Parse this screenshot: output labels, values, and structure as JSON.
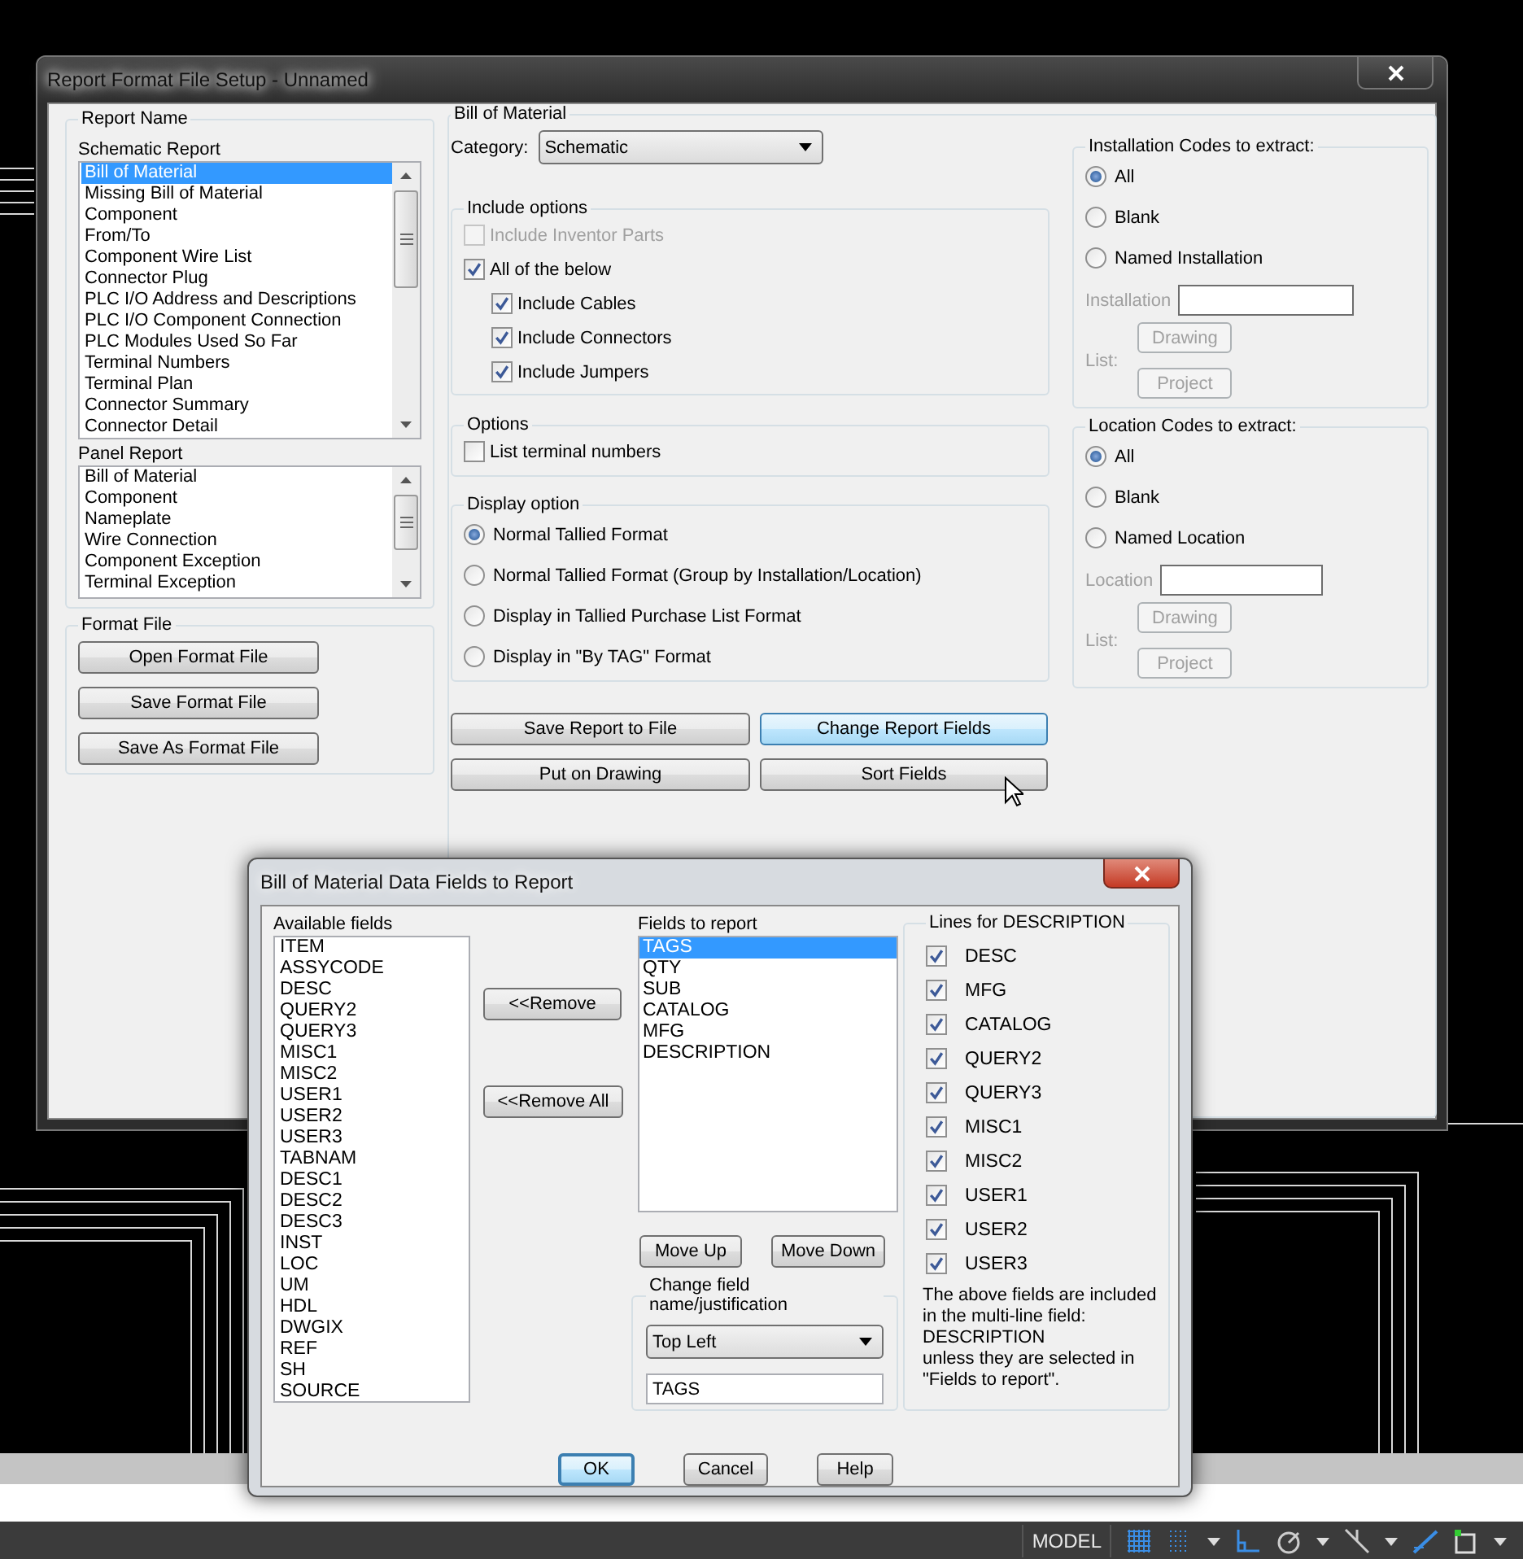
{
  "report_format_setup": {
    "title": "Report Format File Setup - Unnamed",
    "report_name": {
      "label": "Report Name",
      "schematic_label": "Schematic Report",
      "schematic_items": [
        {
          "label": "Bill of Material",
          "selected": true
        },
        {
          "label": "Missing Bill of Material",
          "selected": false
        },
        {
          "label": "Component",
          "selected": false
        },
        {
          "label": "From/To",
          "selected": false
        },
        {
          "label": "Component Wire List",
          "selected": false
        },
        {
          "label": "Connector Plug",
          "selected": false
        },
        {
          "label": "PLC I/O Address and Descriptions",
          "selected": false
        },
        {
          "label": "PLC I/O Component Connection",
          "selected": false
        },
        {
          "label": "PLC Modules Used So Far",
          "selected": false
        },
        {
          "label": "Terminal Numbers",
          "selected": false
        },
        {
          "label": "Terminal Plan",
          "selected": false
        },
        {
          "label": "Connector Summary",
          "selected": false
        },
        {
          "label": "Connector Detail",
          "selected": false
        }
      ],
      "panel_label": "Panel Report",
      "panel_items": [
        {
          "label": "Bill of Material",
          "selected": false
        },
        {
          "label": "Component",
          "selected": false
        },
        {
          "label": "Nameplate",
          "selected": false
        },
        {
          "label": "Wire Connection",
          "selected": false
        },
        {
          "label": "Component Exception",
          "selected": false
        },
        {
          "label": "Terminal Exception",
          "selected": false
        }
      ]
    },
    "format_file": {
      "label": "Format File",
      "buttons": [
        "Open Format File",
        "Save Format File",
        "Save As Format File"
      ]
    },
    "report": {
      "label": "Bill of Material",
      "category_label": "Category:",
      "category_value": "Schematic",
      "include_options": {
        "label": "Include options",
        "items": [
          {
            "label": "Include Inventor Parts",
            "checked": false,
            "disabled": true
          },
          {
            "label": "All of the below",
            "checked": true,
            "disabled": false,
            "children": [
              {
                "label": "Include Cables",
                "checked": true,
                "disabled": false
              },
              {
                "label": "Include Connectors",
                "checked": true,
                "disabled": false
              },
              {
                "label": "Include Jumpers",
                "checked": true,
                "disabled": false
              }
            ]
          }
        ]
      },
      "options": {
        "label": "Options",
        "items": [
          {
            "label": "List terminal numbers",
            "checked": false,
            "disabled": false
          }
        ]
      },
      "display_option": {
        "label": "Display option",
        "items": [
          {
            "label": "Normal Tallied Format",
            "selected": true
          },
          {
            "label": "Normal Tallied Format (Group by Installation/Location)",
            "selected": false
          },
          {
            "label": "Display in Tallied Purchase List Format",
            "selected": false
          },
          {
            "label": "Display in \"By TAG\" Format",
            "selected": false
          }
        ]
      },
      "buttons": [
        {
          "label": "Save Report to File",
          "hovered": false
        },
        {
          "label": "Change Report Fields",
          "hovered": true
        },
        {
          "label": "Put on Drawing",
          "hovered": false
        },
        {
          "label": "Sort Fields",
          "hovered": false
        }
      ],
      "code_groups": [
        {
          "label": "Installation Codes to extract:",
          "options": [
            {
              "label": "All",
              "selected": true
            },
            {
              "label": "Blank",
              "selected": false
            },
            {
              "label": "Named Installation",
              "selected": false
            }
          ],
          "field_label": "Installation",
          "list_label": "List:",
          "buttons": [
            "Drawing",
            "Project"
          ],
          "disabled": true
        },
        {
          "label": "Location Codes to extract:",
          "options": [
            {
              "label": "All",
              "selected": true
            },
            {
              "label": "Blank",
              "selected": false
            },
            {
              "label": "Named Location",
              "selected": false
            }
          ],
          "field_label": "Location",
          "list_label": "List:",
          "buttons": [
            "Drawing",
            "Project"
          ],
          "disabled": true
        }
      ]
    }
  },
  "data_fields_dialog": {
    "title": "Bill of Material Data Fields to Report",
    "available_label": "Available fields",
    "available_fields": [
      "ITEM",
      "ASSYCODE",
      "DESC",
      "QUERY2",
      "QUERY3",
      "MISC1",
      "MISC2",
      "USER1",
      "USER2",
      "USER3",
      "TABNAM",
      "DESC1",
      "DESC2",
      "DESC3",
      "INST",
      "LOC",
      "UM",
      "HDL",
      "DWGIX",
      "REF",
      "SH",
      "SOURCE"
    ],
    "remove_buttons": [
      "<<Remove",
      "<<Remove All"
    ],
    "report_label": "Fields to report",
    "report_fields": [
      {
        "label": "TAGS",
        "selected": true
      },
      {
        "label": "QTY",
        "selected": false
      },
      {
        "label": "SUB",
        "selected": false
      },
      {
        "label": "CATALOG",
        "selected": false
      },
      {
        "label": "MFG",
        "selected": false
      },
      {
        "label": "DESCRIPTION",
        "selected": false
      }
    ],
    "move_buttons": [
      "Move Up",
      "Move Down"
    ],
    "change_group": {
      "label": "Change field name/justification",
      "justification": "Top Left",
      "field_name": "TAGS"
    },
    "lines_group": {
      "label": "Lines for DESCRIPTION",
      "items": [
        {
          "label": "DESC",
          "checked": true
        },
        {
          "label": "MFG",
          "checked": true
        },
        {
          "label": "CATALOG",
          "checked": true
        },
        {
          "label": "QUERY2",
          "checked": true
        },
        {
          "label": "QUERY3",
          "checked": true
        },
        {
          "label": "MISC1",
          "checked": true
        },
        {
          "label": "MISC2",
          "checked": true
        },
        {
          "label": "USER1",
          "checked": true
        },
        {
          "label": "USER2",
          "checked": true
        },
        {
          "label": "USER3",
          "checked": true
        }
      ],
      "note": "The above fields are included\nin the multi-line field:\nDESCRIPTION\nunless they are selected in\n\"Fields to report\"."
    },
    "buttons": [
      {
        "label": "OK",
        "default": true
      },
      {
        "label": "Cancel",
        "default": false
      },
      {
        "label": "Help",
        "default": false
      }
    ]
  },
  "status_bar": {
    "mode": "MODEL"
  }
}
